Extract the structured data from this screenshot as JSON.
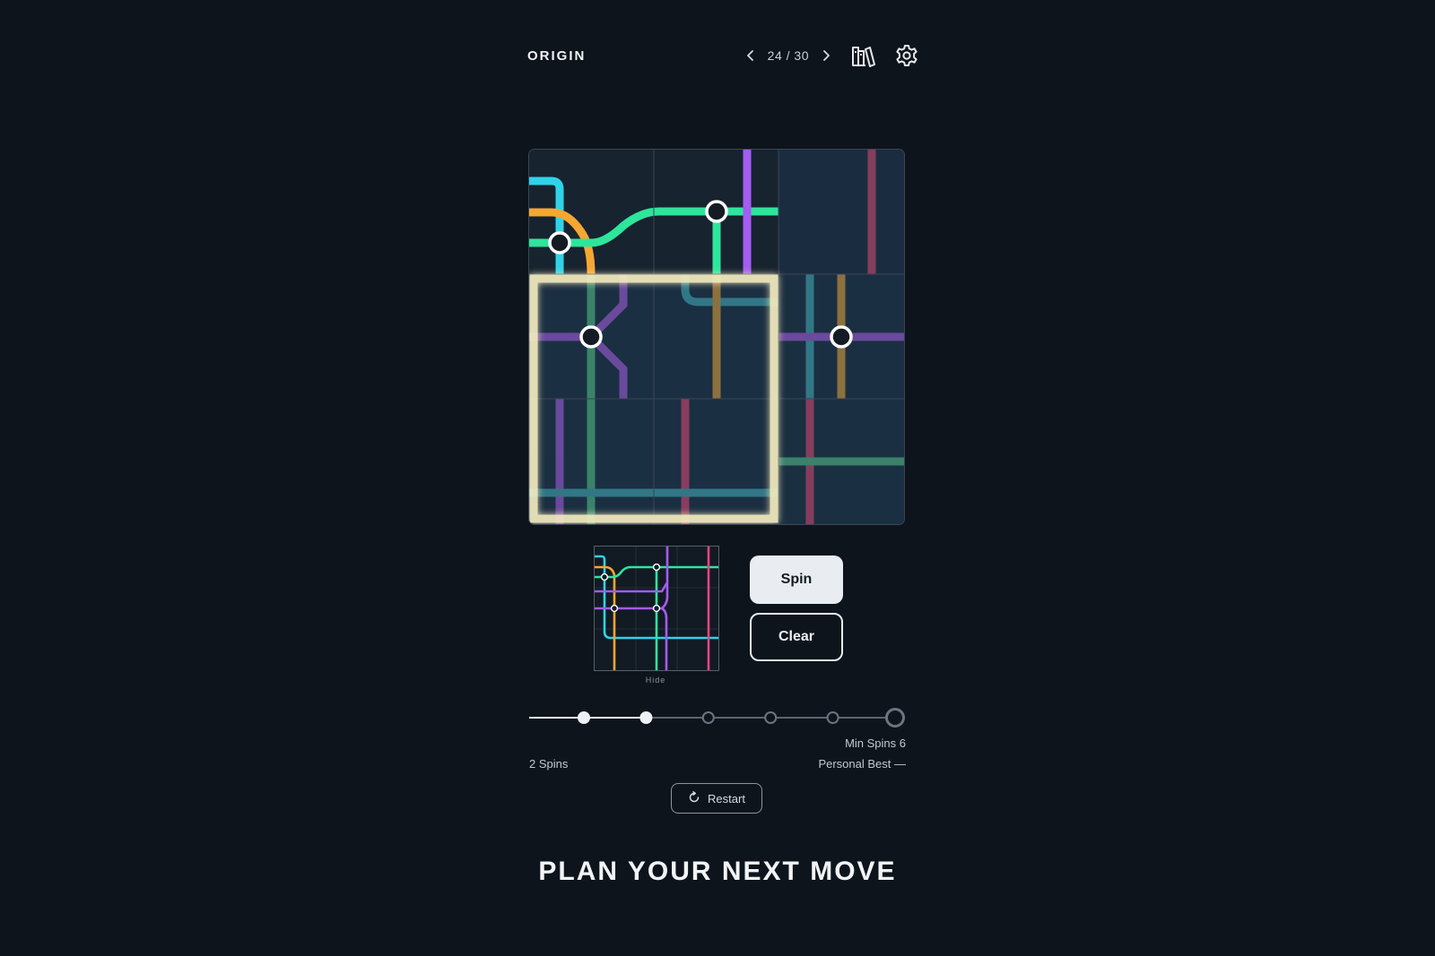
{
  "header": {
    "title": "ORIGIN",
    "level_counter": "24 / 30",
    "prev_icon": "chevron-left-icon",
    "next_icon": "chevron-right-icon",
    "library_icon": "books-icon",
    "settings_icon": "gear-icon"
  },
  "board": {
    "rows": 3,
    "cols": 3,
    "selection": "2x2 block at rows 2-3, columns 1-2",
    "line_colors": {
      "cyan": "#2fd3e8",
      "orange": "#f5a733",
      "green": "#2ee59c",
      "purple": "#a45cf2",
      "pink": "#e8457f",
      "highlight": "#f4ecc0"
    }
  },
  "preview": {
    "caption": "Hide"
  },
  "actions": {
    "spin_label": "Spin",
    "clear_label": "Clear",
    "restart_label": "Restart",
    "restart_icon": "refresh-icon"
  },
  "progress": {
    "steps_total": 6,
    "steps_done": 2
  },
  "stats": {
    "min_spins": "Min Spins 6",
    "spins": "2 Spins",
    "personal_best": "Personal Best —"
  },
  "banner": "PLAN YOUR NEXT MOVE"
}
